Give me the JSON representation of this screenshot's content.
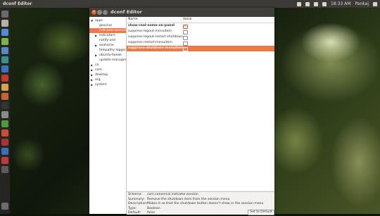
{
  "topbar": {
    "app_title": "dconf Editor",
    "time": "18:33 AM",
    "user": "Pankaj"
  },
  "window": {
    "title": "dconf Editor"
  },
  "tree": {
    "items": [
      {
        "label": "apps",
        "level": 0,
        "expander": "expanded"
      },
      {
        "label": "geoclue",
        "level": 1,
        "expander": "none"
      },
      {
        "label": "indicator-session",
        "level": 1,
        "expander": "none",
        "selected": true
      },
      {
        "label": "indicators",
        "level": 1,
        "expander": "collapsed"
      },
      {
        "label": "notify-osd",
        "level": 1,
        "expander": "none"
      },
      {
        "label": "seahorse",
        "level": 1,
        "expander": "collapsed"
      },
      {
        "label": "telepathy-logger",
        "level": 1,
        "expander": "none"
      },
      {
        "label": "ubuntu-tweak",
        "level": 1,
        "expander": "collapsed"
      },
      {
        "label": "update-manager",
        "level": 1,
        "expander": "none"
      },
      {
        "label": "ca",
        "level": 0,
        "expander": "collapsed"
      },
      {
        "label": "com",
        "level": 0,
        "expander": "collapsed"
      },
      {
        "label": "desktop",
        "level": 0,
        "expander": "collapsed"
      },
      {
        "label": "org",
        "level": 0,
        "expander": "collapsed"
      },
      {
        "label": "system",
        "level": 0,
        "expander": "collapsed"
      }
    ]
  },
  "keys": {
    "header_name": "Name",
    "header_value": "Value",
    "rows": [
      {
        "name": "show-real-name-on-panel",
        "checked": true,
        "bold": true,
        "selected": false
      },
      {
        "name": "suppress-logout-menuitem",
        "checked": false,
        "bold": false,
        "selected": false
      },
      {
        "name": "suppress-logout-restart-shutdown",
        "checked": false,
        "bold": false,
        "selected": false
      },
      {
        "name": "suppress-restart-menuitem",
        "checked": false,
        "bold": false,
        "selected": false
      },
      {
        "name": "suppress-shutdown-menuitem",
        "checked": true,
        "bold": true,
        "selected": true
      }
    ]
  },
  "details": {
    "schema_label": "Schema:",
    "schema_value": "com.canonical.indicator.session",
    "summary_label": "Summary:",
    "summary_value": "Remove the shutdown item from the session menu",
    "description_label": "Description:",
    "description_value": "Makes it so that the shutdown button doesn't show in the session menu",
    "type_label": "Type:",
    "type_value": "Boolean",
    "default_label": "Default:",
    "default_value": "false",
    "set_default_label": "Set to Default"
  },
  "colors": {
    "selection": "#f07746",
    "ubuntu_orange": "#e95420",
    "titlebar": "#3f3e39"
  }
}
